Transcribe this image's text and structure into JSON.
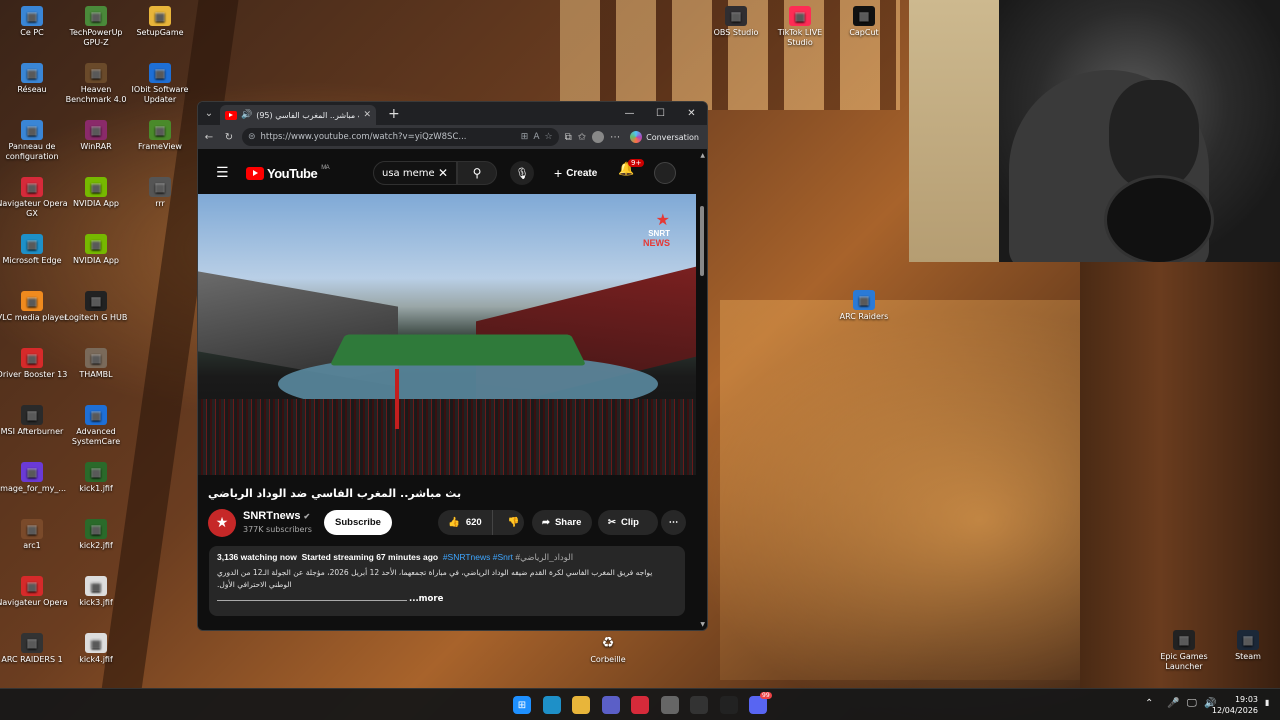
{
  "desktop": {
    "icons_left": [
      {
        "label": "Ce PC",
        "icon": "pc-icon",
        "color": "#3a86d6"
      },
      {
        "label": "TechPowerUp GPU-Z",
        "icon": "gpuz-icon",
        "color": "#4a8a3a"
      },
      {
        "label": "SetupGame",
        "icon": "folder-icon",
        "color": "#e8b53a"
      },
      {
        "label": "Réseau",
        "icon": "network-icon",
        "color": "#3a86d6"
      },
      {
        "label": "Heaven Benchmark 4.0",
        "icon": "heaven-icon",
        "color": "#6a4a2a"
      },
      {
        "label": "IObit Software Updater",
        "icon": "iobit-icon",
        "color": "#1e6fd6"
      },
      {
        "label": "Panneau de configuration",
        "icon": "control-panel-icon",
        "color": "#3a86d6"
      },
      {
        "label": "WinRAR",
        "icon": "winrar-icon",
        "color": "#8a2a6a"
      },
      {
        "label": "FrameView",
        "icon": "frameview-icon",
        "color": "#4a8a2a"
      },
      {
        "label": "Navigateur Opera GX",
        "icon": "opera-gx-icon",
        "color": "#d62a3a"
      },
      {
        "label": "NVIDIA App",
        "icon": "nvidia-icon",
        "color": "#76b900"
      },
      {
        "label": "rrr",
        "icon": "shortcut-icon",
        "color": "#555555"
      },
      {
        "label": "Microsoft Edge",
        "icon": "edge-icon",
        "color": "#1e90c8"
      },
      {
        "label": "NVIDIA App",
        "icon": "nvidia-icon",
        "color": "#76b900"
      },
      {
        "label": "VLC media player",
        "icon": "vlc-icon",
        "color": "#f08a1e"
      },
      {
        "label": "Logitech G HUB",
        "icon": "logitech-icon",
        "color": "#222222"
      },
      {
        "label": "Driver Booster 13",
        "icon": "driver-booster-icon",
        "color": "#d62a2a"
      },
      {
        "label": "THAMBL",
        "icon": "image-icon",
        "color": "#7a6a5a"
      },
      {
        "label": "MSI Afterburner",
        "icon": "afterburner-icon",
        "color": "#2a2a2a"
      },
      {
        "label": "Advanced SystemCare",
        "icon": "systemcare-icon",
        "color": "#1e6fd6"
      },
      {
        "label": "image_for_my_...",
        "icon": "image-icon",
        "color": "#6a3ad6"
      },
      {
        "label": "kick1.jfif",
        "icon": "image-icon",
        "color": "#2a6a2a"
      },
      {
        "label": "arc1",
        "icon": "image-icon",
        "color": "#7a4a2a"
      },
      {
        "label": "kick2.jfif",
        "icon": "image-icon",
        "color": "#2a6a2a"
      },
      {
        "label": "Navigateur Opera",
        "icon": "opera-icon",
        "color": "#d62a2a"
      },
      {
        "label": "kick3.jfif",
        "icon": "image-icon",
        "color": "#dddddd"
      },
      {
        "label": "ARC RAIDERS 1",
        "icon": "image-icon",
        "color": "#333333"
      },
      {
        "label": "kick4.jfif",
        "icon": "image-icon",
        "color": "#dddddd"
      }
    ],
    "icons_right": [
      {
        "label": "OBS Studio",
        "icon": "obs-icon",
        "color": "#302e31"
      },
      {
        "label": "TikTok LIVE Studio",
        "icon": "tiktok-icon",
        "color": "#fe2c55"
      },
      {
        "label": "CapCut",
        "icon": "capcut-icon",
        "color": "#111111"
      },
      {
        "label": "ARC Raiders",
        "icon": "arc-raiders-icon",
        "color": "#2a7ad6"
      },
      {
        "label": "Epic Games Launcher",
        "icon": "epic-icon",
        "color": "#222222"
      },
      {
        "label": "Steam",
        "icon": "steam-icon",
        "color": "#1b2838"
      }
    ],
    "recycle_bin": "Corbeille"
  },
  "browser": {
    "tab_title": "(95) بث مباشر.. المغرب الفاسي",
    "url": "https://www.youtube.com/watch?v=yiQzW8SC...",
    "conversation_label": "Conversation"
  },
  "youtube": {
    "logo_text": "YouTube",
    "region": "MA",
    "search_query": "usa memes",
    "create_label": "Create",
    "notification_count": "9+",
    "watermark_line1": "SNRT",
    "watermark_line2": "NEWS",
    "video_title": "بث مباشر.. المغرب الفاسي ضد الوداد الرياضي",
    "channel_name": "SNRTnews",
    "subscribers": "377K subscribers",
    "subscribe_label": "Subscribe",
    "likes": "620",
    "share_label": "Share",
    "clip_label": "Clip",
    "watching": "3,136 watching now",
    "started": "Started streaming 67 minutes ago",
    "hashtags": "#SNRTnews #Snrt",
    "hashtag_ar": "#الوداد_الرياضي",
    "description": "يواجه فريق المغرب الفاسي لكرة القدم ضيفه الوداد الرياضي، في مباراة تجمعهما، الأحد 12 أبريل 2026، مؤجلة عن الجولة الـ12 من الدوري الوطني الاحترافي الأول.",
    "more_label": "...more"
  },
  "taskbar": {
    "time": "19:03",
    "date": "12/04/2026",
    "apps": [
      "windows-start-icon",
      "edge-icon",
      "file-explorer-icon",
      "teams-icon",
      "opera-gx-icon",
      "steelseries-icon",
      "github-icon",
      "epic-icon",
      "discord-icon"
    ],
    "discord_badge": "99"
  }
}
